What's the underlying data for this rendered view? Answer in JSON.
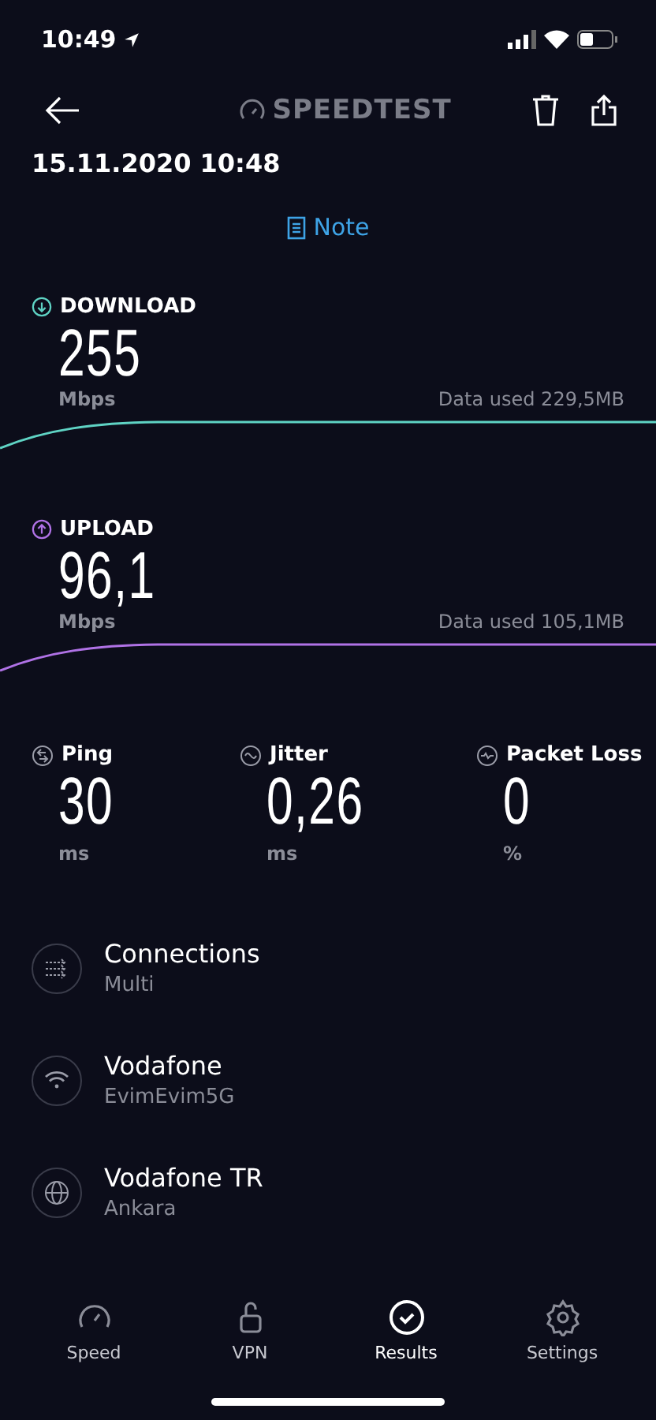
{
  "status_bar": {
    "time": "10:49"
  },
  "header": {
    "logo": "SPEEDTEST",
    "date": "15.11.2020 10:48",
    "note": "Note"
  },
  "transfers": [
    {
      "kind": "download",
      "label": "DOWNLOAD",
      "value": "255",
      "unit": "Mbps",
      "data_used": "Data used 229,5MB",
      "color": "#5fd3c4"
    },
    {
      "kind": "upload",
      "label": "UPLOAD",
      "value": "96,1",
      "unit": "Mbps",
      "data_used": "Data used 105,1MB",
      "color": "#b072e6"
    }
  ],
  "stats": [
    {
      "kind": "ping",
      "label": "Ping",
      "value": "30",
      "unit": "ms"
    },
    {
      "kind": "jitter",
      "label": "Jitter",
      "value": "0,26",
      "unit": "ms"
    },
    {
      "kind": "loss",
      "label": "Packet Loss",
      "value": "0",
      "unit": "%"
    }
  ],
  "details": [
    {
      "kind": "connections",
      "title": "Connections",
      "subtitle": "Multi"
    },
    {
      "kind": "wifi",
      "title": "Vodafone",
      "subtitle": "EvimEvim5G"
    },
    {
      "kind": "globe",
      "title": "Vodafone TR",
      "subtitle": "Ankara"
    }
  ],
  "tabs": [
    {
      "kind": "speed",
      "label": "Speed",
      "selected": false
    },
    {
      "kind": "vpn",
      "label": "VPN",
      "selected": false
    },
    {
      "kind": "results",
      "label": "Results",
      "selected": true
    },
    {
      "kind": "settings",
      "label": "Settings",
      "selected": false
    }
  ]
}
